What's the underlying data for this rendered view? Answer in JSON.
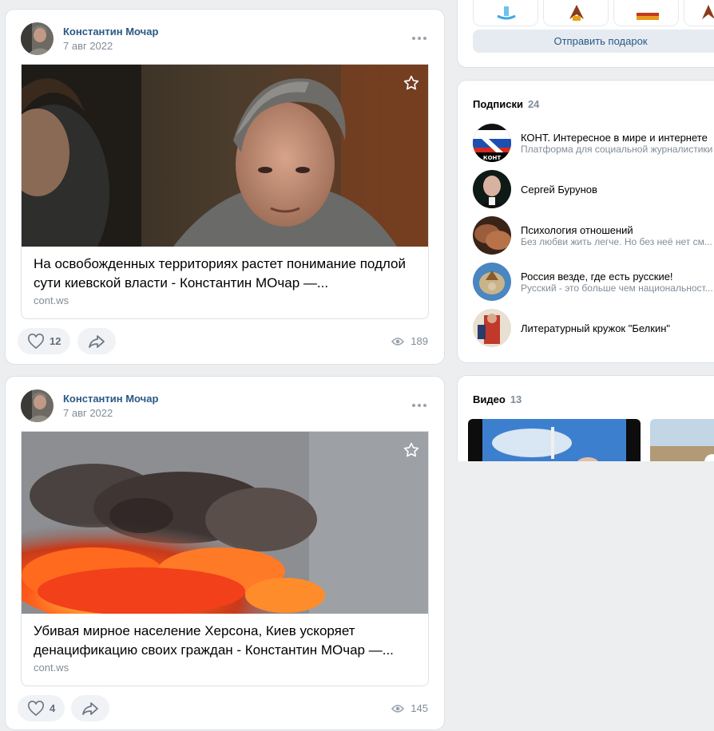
{
  "posts": [
    {
      "author": "Константин Мочар",
      "date": "7 авг 2022",
      "link_title": "На освобожденных территориях растет понимание подлой сути киевской власти - Константин МОчар —...",
      "link_host": "cont.ws",
      "likes": "12",
      "views": "189"
    },
    {
      "author": "Константин Мочар",
      "date": "7 авг 2022",
      "link_title": "Убивая мирное население Херсона, Киев ускоряет денацификацию своих граждан - Константин МОчар —...",
      "link_host": "cont.ws",
      "likes": "4",
      "views": "145"
    }
  ],
  "gifts": {
    "send_label": "Отправить подарок"
  },
  "subscriptions": {
    "title": "Подписки",
    "count": "24",
    "items": [
      {
        "name": "КОНТ. Интересное в мире и интернете",
        "desc": "Платформа для социальной журналистики"
      },
      {
        "name": "Сергей Бурунов",
        "desc": ""
      },
      {
        "name": "Психология отношений",
        "desc": "Без любви жить легче. Но без неё нет см..."
      },
      {
        "name": "Россия везде, где есть русские!",
        "desc": "Русский - это больше чем национальност..."
      },
      {
        "name": "Литературный кружок \"Белкин\"",
        "desc": ""
      }
    ],
    "kont_logo_text": "КОНТ"
  },
  "videos": {
    "title": "Видео",
    "count": "13"
  },
  "colors": {
    "link": "#2a5885",
    "muted": "#818c99",
    "bg": "#edeef0"
  }
}
